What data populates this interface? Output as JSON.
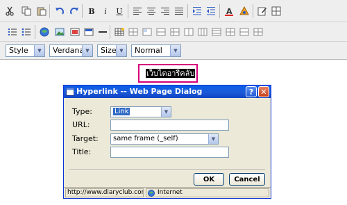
{
  "editor": {
    "toolbar": {
      "style_combo": "Style",
      "font_combo": "Verdana",
      "size_combo": "Size",
      "format_combo": "Normal",
      "bold": "B",
      "italic": "i",
      "underline": "U"
    },
    "selected_text": "เว็บไดอารี่คลับ"
  },
  "dialog": {
    "title": "Hyperlink -- Web Page Dialog",
    "help": "?",
    "close": "✕",
    "type_label": "Type:",
    "type_value": "Link",
    "url_label": "URL:",
    "url_value": "",
    "target_label": "Target:",
    "target_value": "same frame (_self)",
    "title_label": "Title:",
    "title_value": "",
    "ok": "OK",
    "cancel": "Cancel",
    "status_url": "http://www.diaryclub.com/c",
    "status_zone": "Internet"
  },
  "colors": {
    "highlight": "#d6007a",
    "title_bar": "#0a5eea"
  }
}
